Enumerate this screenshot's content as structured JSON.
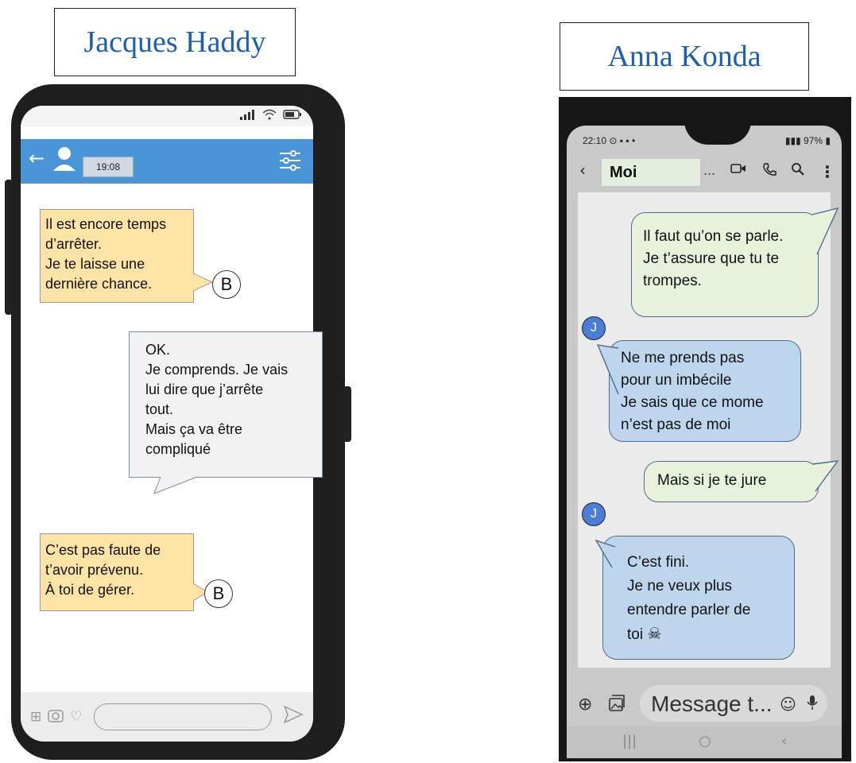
{
  "left": {
    "contact_name": "Jacques Haddy",
    "header_time": "19:08",
    "messages": [
      {
        "lines": [
          "Il est encore temps",
          "d’arrêter.",
          "Je te laisse une",
          "dernière chance."
        ],
        "sender": "B"
      },
      {
        "lines": [
          "OK.",
          "Je comprends. Je vais",
          "lui dire que j’arrête",
          "tout.",
          "Mais ça va être",
          "compliqué"
        ]
      },
      {
        "lines": [
          "C’est pas faute de",
          "t’avoir prévenu.",
          "À toi de gérer."
        ],
        "sender": "B"
      }
    ]
  },
  "right": {
    "contact_name": "Anna Konda",
    "status_time": "22:10",
    "battery": "97%",
    "chat_title": "Moi",
    "messages": [
      {
        "lines": [
          "Il faut qu’on se parle.",
          "Je t’assure que tu te",
          "trompes."
        ]
      },
      {
        "sender": "J",
        "lines": [
          "Ne me prends pas",
          "pour un imbécile",
          "Je sais que ce mome",
          "n’est pas de moi"
        ]
      },
      {
        "lines": [
          "Mais si je te jure"
        ]
      },
      {
        "sender": "J",
        "lines": [
          "C’est fini.",
          "Je ne veux plus",
          "entendre parler de",
          "toi"
        ]
      }
    ],
    "input_placeholder": "Message t..."
  }
}
